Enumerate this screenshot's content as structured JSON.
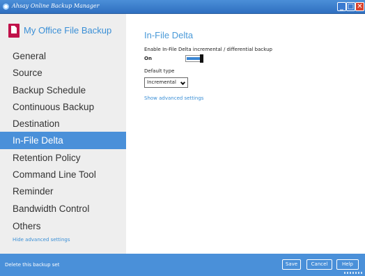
{
  "window": {
    "title": "Ahsay Online Backup Manager",
    "min_glyph": "_",
    "max_glyph": "□",
    "close_glyph": "✕"
  },
  "sidebar": {
    "backup_set_name": "My Office File Backup",
    "backup_set_icon": "document-icon",
    "items": [
      {
        "label": "General"
      },
      {
        "label": "Source"
      },
      {
        "label": "Backup Schedule"
      },
      {
        "label": "Continuous Backup"
      },
      {
        "label": "Destination"
      },
      {
        "label": "In-File Delta",
        "active": true
      },
      {
        "label": "Retention Policy"
      },
      {
        "label": "Command Line Tool"
      },
      {
        "label": "Reminder"
      },
      {
        "label": "Bandwidth Control"
      },
      {
        "label": "Others"
      }
    ],
    "hide_advanced_label": "Hide advanced settings"
  },
  "main": {
    "title": "In-File Delta",
    "enable_label": "Enable In-File Delta incremental / differential backup",
    "toggle_state": "On",
    "toggle_on": true,
    "default_type_label": "Default type",
    "default_type_value": "Incremental",
    "show_advanced_label": "Show advanced settings"
  },
  "footer": {
    "delete_label": "Delete this backup set",
    "save_label": "Save",
    "cancel_label": "Cancel",
    "help_label": "Help"
  },
  "colors": {
    "accent": "#4a90d9",
    "title_bar": "#2f6fc0",
    "link": "#3a8fd6",
    "set_icon": "#c0124a"
  }
}
